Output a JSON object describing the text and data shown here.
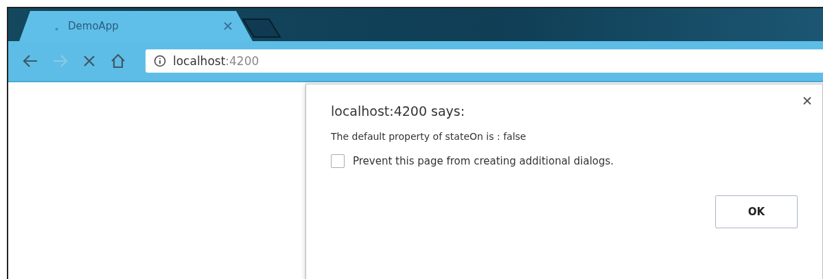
{
  "tabs": [
    {
      "title": "DemoApp",
      "selected": true
    }
  ],
  "toolbar": {
    "forward_disabled": true
  },
  "address_bar": {
    "host": "localhost",
    "port": ":4200"
  },
  "dialog": {
    "title": "localhost:4200 says:",
    "message": "The default property of stateOn is : false",
    "checkbox": {
      "label": "Prevent this page from creating additional dialogs.",
      "checked": false
    },
    "buttons": [
      "OK"
    ]
  }
}
